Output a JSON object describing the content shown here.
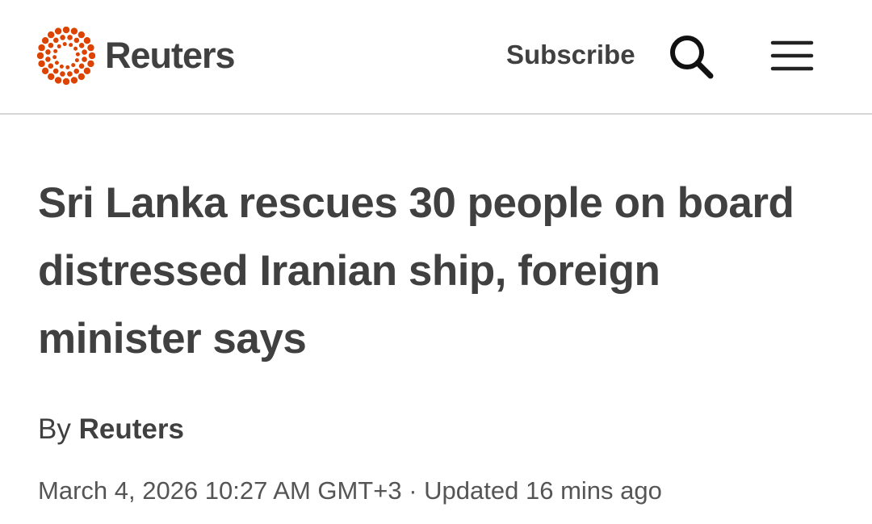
{
  "header": {
    "brand": "Reuters",
    "subscribe_label": "Subscribe",
    "brand_color": "#dc4300",
    "icons": {
      "logo": "reuters-dot-ring-icon",
      "search": "search-icon",
      "menu": "hamburger-menu-icon"
    }
  },
  "article": {
    "headline": "Sri Lanka rescues 30 people on board distressed Iranian ship, foreign minister says",
    "byline_prefix": "By ",
    "author": "Reuters",
    "timestamp": "March 4, 2026 10:27 AM GMT+3",
    "separator": " · ",
    "updated": "Updated 16 mins ago"
  }
}
